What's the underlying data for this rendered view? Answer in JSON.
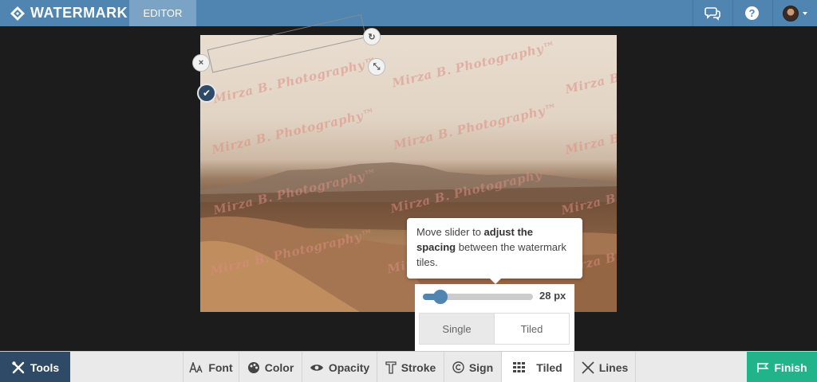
{
  "header": {
    "logo_text": "WATERMARK",
    "tab_editor": "EDITOR",
    "help_label": "?"
  },
  "photo": {
    "watermark_text": "Mirza B. Photography™"
  },
  "controls": {
    "close_glyph": "×",
    "rotate_glyph": "↻",
    "resize_glyph": "⤡",
    "confirm_glyph": "✔"
  },
  "tooltip": {
    "text_before": "Move slider to ",
    "text_bold": "adjust the spacing",
    "text_after": " between the watermark tiles."
  },
  "spacing": {
    "value_label": "28 px",
    "slider_fraction": 0.16,
    "mode_single": "Single",
    "mode_tiled": "Tiled",
    "selected_mode": "Single"
  },
  "toolbar": {
    "tools": "Tools",
    "font": "Font",
    "color": "Color",
    "opacity": "Opacity",
    "stroke": "Stroke",
    "sign": "Sign",
    "tiled": "Tiled",
    "lines": "Lines",
    "finish": "Finish"
  },
  "colors": {
    "header": "#5185b1",
    "accent_dark": "#2f4a66",
    "finish": "#21b38a"
  }
}
